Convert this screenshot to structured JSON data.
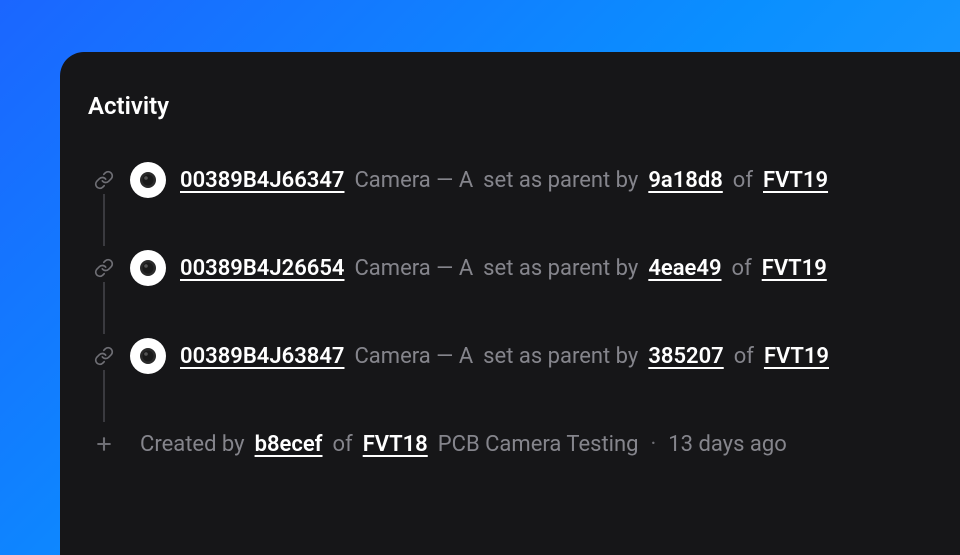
{
  "title": "Activity",
  "items": [
    {
      "serial": "00389B4J66347",
      "device": "Camera — A",
      "action": "set as parent by",
      "hash": "9a18d8",
      "of": "of",
      "station": "FVT19"
    },
    {
      "serial": "00389B4J26654",
      "device": "Camera — A",
      "action": "set as parent by",
      "hash": "4eae49",
      "of": "of",
      "station": "FVT19"
    },
    {
      "serial": "00389B4J63847",
      "device": "Camera — A",
      "action": "set as parent by",
      "hash": "385207",
      "of": "of",
      "station": "FVT19"
    }
  ],
  "created": {
    "prefix": "Created by",
    "hash": "b8ecef",
    "of": "of",
    "station": "FVT18",
    "description": "PCB Camera Testing",
    "separator": "·",
    "time": "13 days ago"
  }
}
